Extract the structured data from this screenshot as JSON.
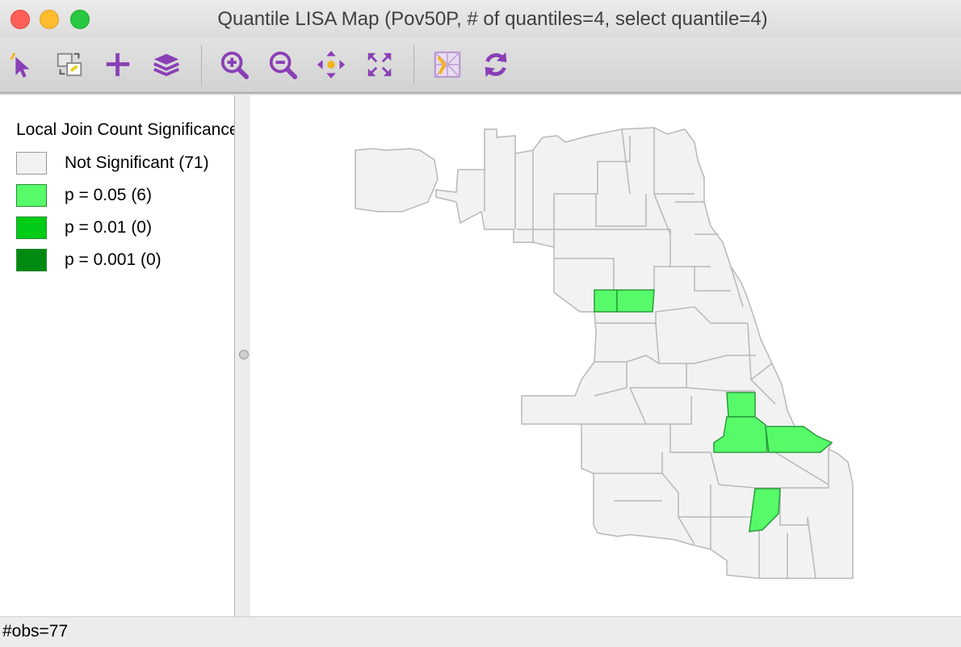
{
  "window": {
    "title": "Quantile LISA Map (Pov50P, # of quantiles=4, select quantile=4)"
  },
  "toolbar": {
    "buttons": [
      {
        "name": "select-pointer",
        "icon": "pointer-arrow-icon"
      },
      {
        "name": "selection-shape",
        "icon": "selection-shape-icon"
      },
      {
        "name": "add-layer",
        "icon": "plus-icon"
      },
      {
        "name": "layers",
        "icon": "layers-icon"
      },
      {
        "name": "zoom-in",
        "icon": "zoom-in-icon"
      },
      {
        "name": "zoom-out",
        "icon": "zoom-out-icon"
      },
      {
        "name": "pan",
        "icon": "pan-arrows-icon"
      },
      {
        "name": "full-extent",
        "icon": "full-extent-icon"
      },
      {
        "name": "basemap",
        "icon": "basemap-icon"
      },
      {
        "name": "refresh",
        "icon": "refresh-icon"
      }
    ],
    "icon_color": "#8a3fb6"
  },
  "legend": {
    "title": "Local Join Count Significance",
    "items": [
      {
        "label": "Not Significant (71)",
        "color": "#f2f2f2"
      },
      {
        "label": "p = 0.05 (6)",
        "color": "#57fb6a"
      },
      {
        "label": "p = 0.01 (0)",
        "color": "#00cc17"
      },
      {
        "label": "p = 0.001 (0)",
        "color": "#008a10"
      }
    ]
  },
  "map": {
    "not_significant_color": "#f2f2f2",
    "significant_color": "#57fb6a",
    "border_color": "#b8b8b8",
    "significant_border_color": "#2a9c3a"
  },
  "status": {
    "text": "#obs=77"
  }
}
